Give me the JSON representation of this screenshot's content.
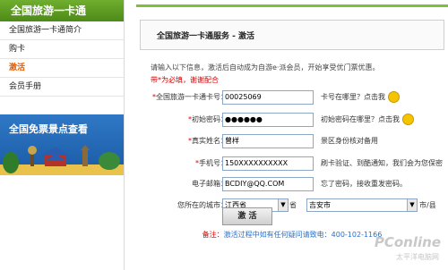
{
  "sidebar": {
    "title": "全国旅游一卡通",
    "items": [
      {
        "label": "全国旅游一卡通简介",
        "active": false
      },
      {
        "label": "购卡",
        "active": false
      },
      {
        "label": "激活",
        "active": true
      },
      {
        "label": "会员手册",
        "active": false
      }
    ],
    "banner": "全国免票景点查看"
  },
  "main": {
    "section_title": "全国旅游一卡通服务 - 激活",
    "intro": "请输入以下信息，激活后自动成为自游e·派会员，开始享受优门票优惠。",
    "required_note": "带*为必填，谢谢配合",
    "fields": {
      "card_no": {
        "label": "全国旅游一卡通卡号：",
        "value": "00025069",
        "hint": "卡号在哪里？点击我"
      },
      "password": {
        "label": "初始密码：",
        "value": "●●●●●●",
        "hint": "初始密码在哪里？点击我"
      },
      "name": {
        "label": "真实姓名：",
        "value": "曾样",
        "hint": "景区身份核对备用"
      },
      "phone": {
        "label": "手机号：",
        "value": "150XXXXXXXXXX",
        "hint": "刷卡验证、到酷通知，我们会为您保密"
      },
      "email": {
        "label": "电子邮箱：",
        "value": "BCDIY@QQ.COM",
        "hint": "忘了密码，接收重发密码。"
      },
      "city": {
        "label": "您所在的城市：",
        "province": "江西省",
        "province_suffix": "省",
        "city": "吉安市",
        "city_suffix": "市/县"
      }
    },
    "submit_label": "激 活",
    "footer_label": "备注：",
    "footer_text": "激活过程中如有任何疑问请致电：400-102-1166"
  },
  "watermark": {
    "brand": "PConline",
    "sub": "太平洋电脑网"
  },
  "colors": {
    "accent_green": "#7cbf3b",
    "required_red": "#d90000",
    "link_blue": "#2d6fc4"
  }
}
